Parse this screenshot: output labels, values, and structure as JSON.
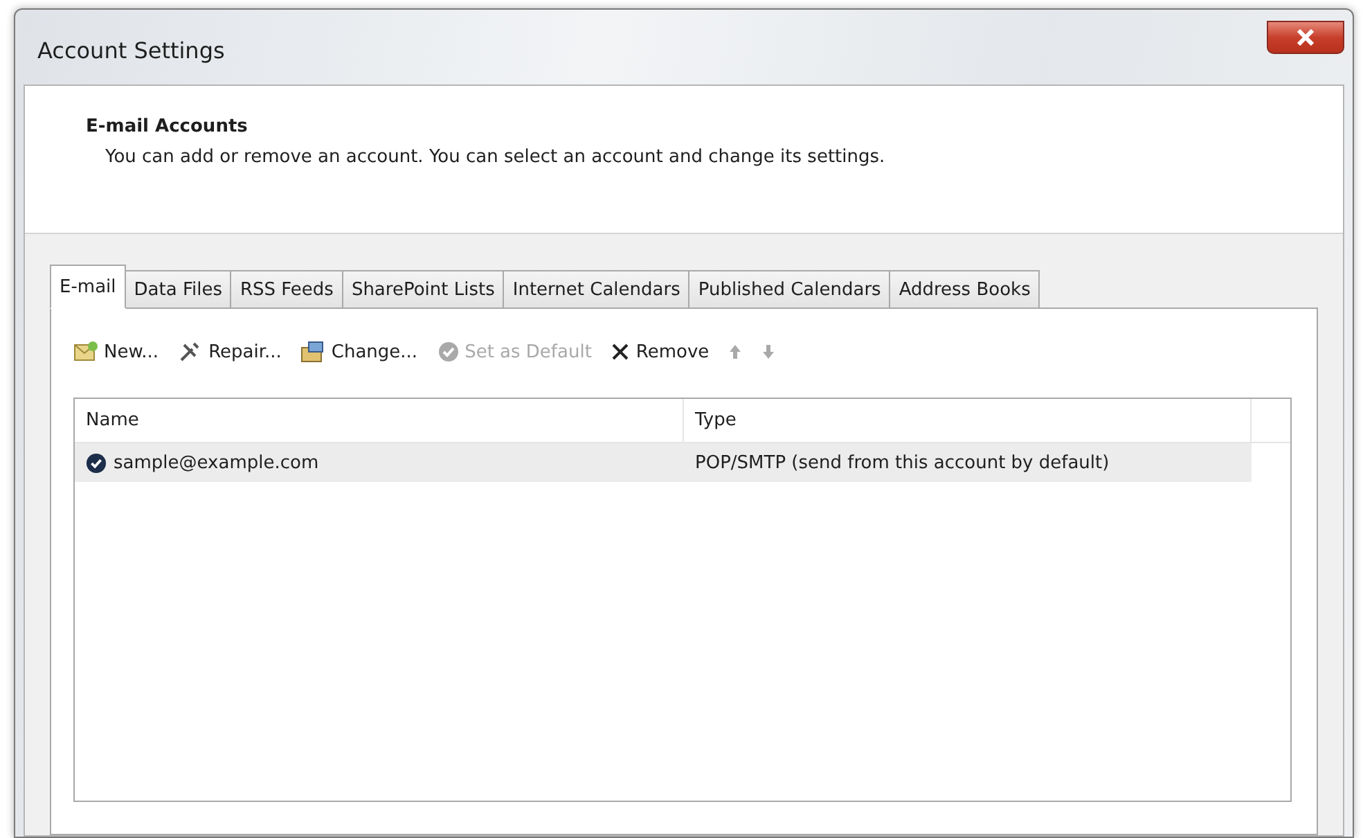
{
  "window": {
    "title": "Account Settings"
  },
  "header": {
    "title": "E-mail Accounts",
    "description": "You can add or remove an account. You can select an account and change its settings."
  },
  "tabs": [
    {
      "label": "E-mail",
      "selected": true
    },
    {
      "label": "Data Files",
      "selected": false
    },
    {
      "label": "RSS Feeds",
      "selected": false
    },
    {
      "label": "SharePoint Lists",
      "selected": false
    },
    {
      "label": "Internet Calendars",
      "selected": false
    },
    {
      "label": "Published Calendars",
      "selected": false
    },
    {
      "label": "Address Books",
      "selected": false
    }
  ],
  "toolbar": [
    {
      "kind": "new",
      "label": "New...",
      "disabled": false
    },
    {
      "kind": "repair",
      "label": "Repair...",
      "disabled": false
    },
    {
      "kind": "change",
      "label": "Change...",
      "disabled": false
    },
    {
      "kind": "default",
      "label": "Set as Default",
      "disabled": true
    },
    {
      "kind": "remove",
      "label": "Remove",
      "disabled": false
    },
    {
      "kind": "up",
      "disabled": true
    },
    {
      "kind": "down",
      "disabled": true
    }
  ],
  "table": {
    "columns": [
      "Name",
      "Type"
    ],
    "rows": [
      {
        "name": "sample@example.com",
        "type": "POP/SMTP (send from this account by default)",
        "selected": true,
        "default": true
      }
    ]
  }
}
